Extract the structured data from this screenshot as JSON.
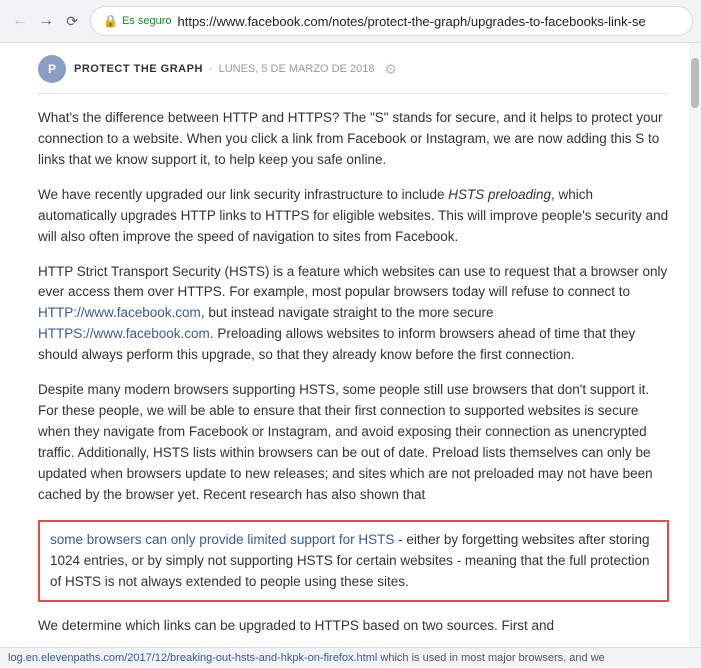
{
  "browser": {
    "secure_label": "Es seguro",
    "url": "https://www.facebook.com/notes/protect-the-graph/upgrades-to-facebooks-link-se"
  },
  "note_header": {
    "source": "PROTECT THE GRAPH",
    "separator": "·",
    "date": "LUNES, 5 DE MARZO DE 2018"
  },
  "article": {
    "paragraph1": "What's the difference between HTTP and HTTPS? The \"S\" stands for secure, and it helps to protect your connection to a website. When you click a link from Facebook or Instagram, we are now adding this S to links that we know support it, to help keep you safe online.",
    "paragraph2_pre": "We have recently upgraded our link security infrastructure to include ",
    "paragraph2_em": "HSTS preloading",
    "paragraph2_post": ", which automatically upgrades HTTP links to HTTPS for eligible websites. This will improve people's security and will also often improve the speed of navigation to sites from Facebook.",
    "paragraph3_pre": "HTTP Strict Transport Security (HSTS) is a feature which websites can use to request that a browser only ever access them over HTTPS. For example, most popular browsers today will refuse to connect to ",
    "paragraph3_link1": "HTTP://www.facebook.com",
    "paragraph3_link1_href": "http://www.facebook.com",
    "paragraph3_mid": ", but instead navigate straight to the more secure ",
    "paragraph3_link2": "HTTPS://www.facebook.com",
    "paragraph3_link2_href": "https://www.facebook.com",
    "paragraph3_post": ". Preloading allows websites to inform browsers ahead of time that they should always perform this upgrade, so that they already know before the first connection.",
    "paragraph4": "Despite many modern browsers supporting HSTS, some people still use browsers that don't support it. For these people, we will be able to ensure that their first connection to supported websites is secure when they navigate from Facebook or Instagram, and avoid exposing their connection as unencrypted traffic. Additionally, HSTS lists within browsers can be out of date. Preload lists themselves can only be updated when browsers update to new releases; and sites which are not preloaded may not have been cached by the browser yet. Recent research has also shown that ",
    "paragraph4_link": "some browsers can only provide limited support for HSTS",
    "paragraph4_link_href": "#",
    "paragraph4_end": " - either by forgetting websites after storing 1024 entries, or by simply not supporting HSTS for certain websites - meaning that the full protection of HSTS is not always extended to people using these sites.",
    "paragraph5_pre": "We determine which links can be upgraded to HTTPS based on two sources. First and",
    "bottom_link": "log.en.elevenpaths.com/2017/12/breaking-out-hsts-and-hkpk-on-firefox.html",
    "bottom_link_suffix": "which is used in most major browsers, and we"
  }
}
